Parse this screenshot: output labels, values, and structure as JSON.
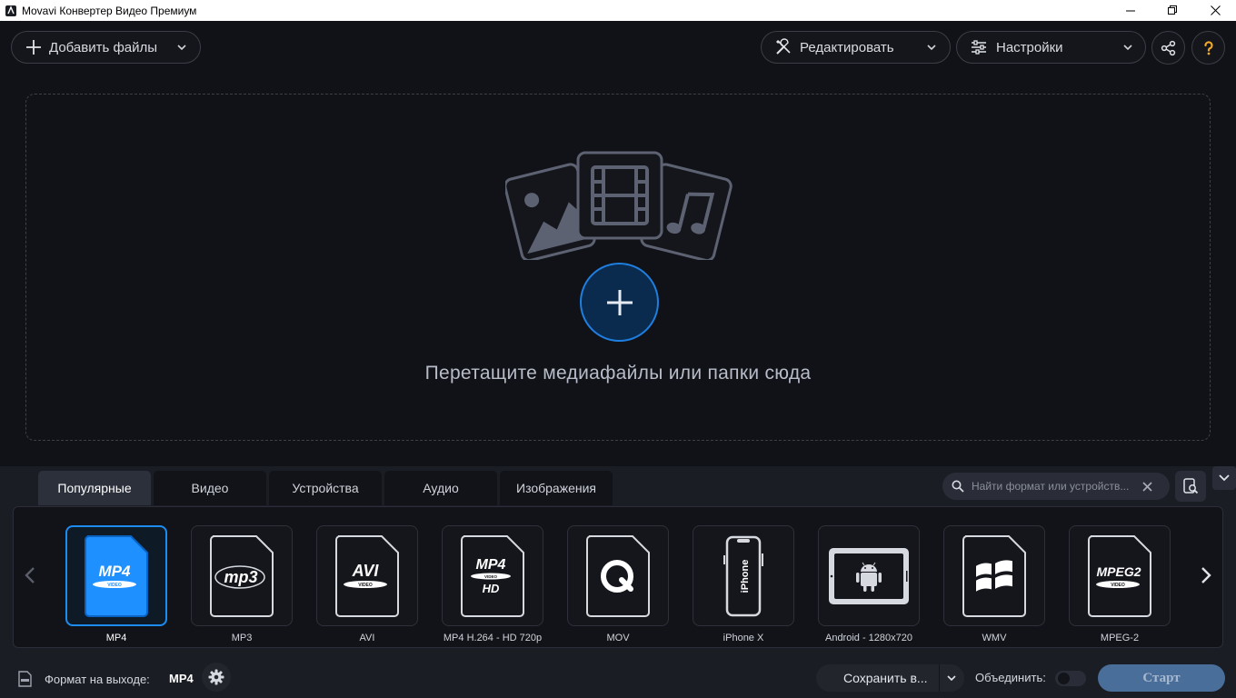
{
  "window": {
    "title": "Movavi Конвертер Видео Премиум"
  },
  "toolbar": {
    "add_files_label": "Добавить файлы",
    "edit_label": "Редактировать",
    "settings_label": "Настройки"
  },
  "dropzone": {
    "hint": "Перетащите медиафайлы или папки сюда"
  },
  "tabs": [
    {
      "label": "Популярные",
      "active": true
    },
    {
      "label": "Видео",
      "active": false
    },
    {
      "label": "Устройства",
      "active": false
    },
    {
      "label": "Аудио",
      "active": false
    },
    {
      "label": "Изображения",
      "active": false
    }
  ],
  "search": {
    "placeholder": "Найти формат или устройств..."
  },
  "formats": [
    {
      "label": "MP4",
      "icon": "mp4-icon",
      "selected": true
    },
    {
      "label": "MP3",
      "icon": "mp3-icon",
      "selected": false
    },
    {
      "label": "AVI",
      "icon": "avi-icon",
      "selected": false
    },
    {
      "label": "MP4 H.264 - HD 720p",
      "icon": "mp4-hd-icon",
      "selected": false
    },
    {
      "label": "MOV",
      "icon": "quicktime-icon",
      "selected": false
    },
    {
      "label": "iPhone X",
      "icon": "iphone-icon",
      "selected": false
    },
    {
      "label": "Android - 1280x720",
      "icon": "android-tablet-icon",
      "selected": false
    },
    {
      "label": "WMV",
      "icon": "windows-icon",
      "selected": false
    },
    {
      "label": "MPEG-2",
      "icon": "mpeg2-icon",
      "selected": false
    }
  ],
  "icon_text": {
    "mp4": "MP4",
    "video": "VIDEO",
    "mp3": "mp3",
    "avi": "AVI",
    "hd": "HD",
    "iphone": "iPhone",
    "mpeg2": "MPEG2"
  },
  "status": {
    "output_format_label": "Формат на выходе:",
    "output_format_value": "MP4",
    "save_to_label": "Сохранить в...",
    "merge_label": "Объединить:",
    "merge_enabled": false,
    "start_label": "Старт"
  },
  "colors": {
    "accent": "#1d8cf0",
    "background": "#111217",
    "panel": "#1b1d24",
    "start_button": "#4a6e9a"
  }
}
